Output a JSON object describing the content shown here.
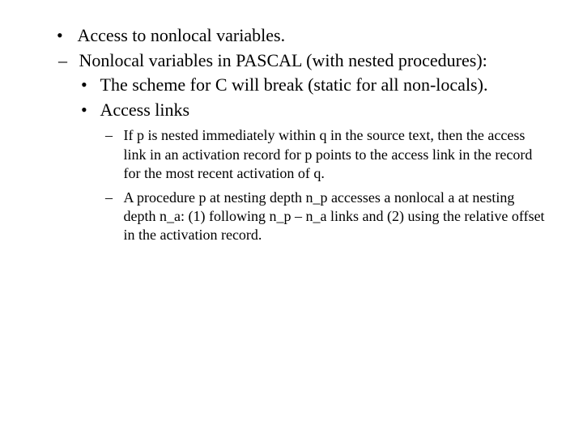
{
  "bullets": {
    "dot": "•",
    "dash": "–"
  },
  "lvl1": {
    "item1": "Access to nonlocal variables."
  },
  "lvl2": {
    "item1": "Nonlocal variables in PASCAL (with nested procedures):"
  },
  "lvl3": {
    "item1": "The scheme for C will break (static for all non-locals).",
    "item2": "Access links"
  },
  "lvl4": {
    "item1": "If p is nested immediately within q in the source text, then the access link in an activation record for p points to the access link in the record for the most recent activation of q.",
    "item2": "A procedure p at nesting depth n_p accesses a nonlocal a at nesting depth n_a: (1) following n_p – n_a links and (2) using the relative offset in the activation record."
  }
}
